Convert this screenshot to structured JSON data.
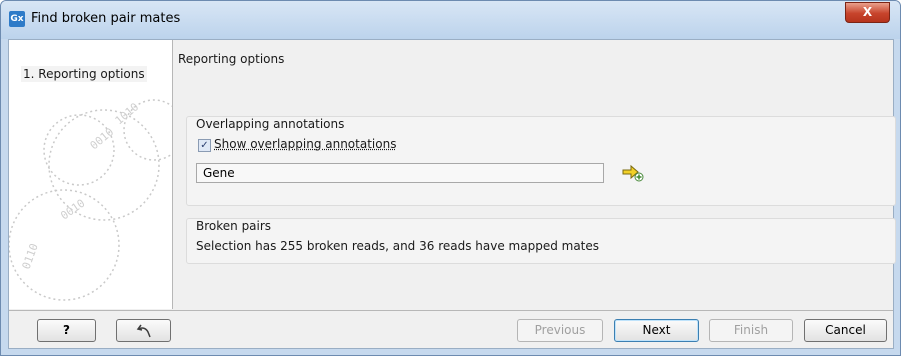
{
  "window": {
    "title": "Find broken pair mates",
    "app_icon_label": "Gx",
    "close_label": "X"
  },
  "wizard": {
    "steps": [
      {
        "label": "1.  Reporting options"
      }
    ]
  },
  "main": {
    "section_title": "Reporting options",
    "overlapping": {
      "label": "Overlapping annotations",
      "checkbox_label": "Show overlapping annotations",
      "checked": true,
      "input_value": "Gene"
    },
    "broken_pairs": {
      "label": "Broken pairs",
      "text": "Selection has 255 broken reads, and 36 reads have mapped mates"
    }
  },
  "footer": {
    "help_label": "?",
    "previous_label": "Previous",
    "next_label": "Next",
    "finish_label": "Finish",
    "cancel_label": "Cancel"
  }
}
